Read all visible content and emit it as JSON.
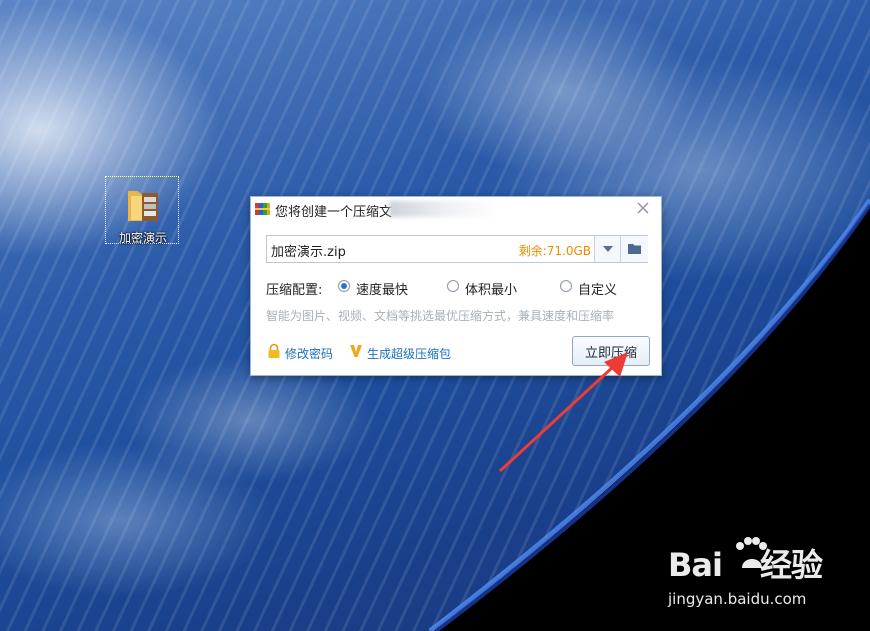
{
  "desktop": {
    "icon_label": "加密演示"
  },
  "dialog": {
    "title": "您将创建一个压缩文",
    "path": {
      "filename": "加密演示.zip",
      "free_space": "剩余:71.0GB"
    },
    "config": {
      "label": "压缩配置:",
      "options": [
        {
          "label": "速度最快",
          "selected": true
        },
        {
          "label": "体积最小",
          "selected": false
        },
        {
          "label": "自定义",
          "selected": false
        }
      ]
    },
    "hint": "智能为图片、视频、文档等挑选最优压缩方式，兼具速度和压缩率",
    "links": {
      "change_password": "修改密码",
      "super_package": "生成超级压缩包"
    },
    "compress_button": "立即压缩"
  },
  "watermark": {
    "brand_left": "Bai",
    "brand_right": "经验",
    "url": "jingyan.baidu.com"
  },
  "colors": {
    "accent": "#2f6fd6",
    "free_space": "#f08a00",
    "link": "#1a6fc2",
    "arrow": "#ee3b35"
  }
}
